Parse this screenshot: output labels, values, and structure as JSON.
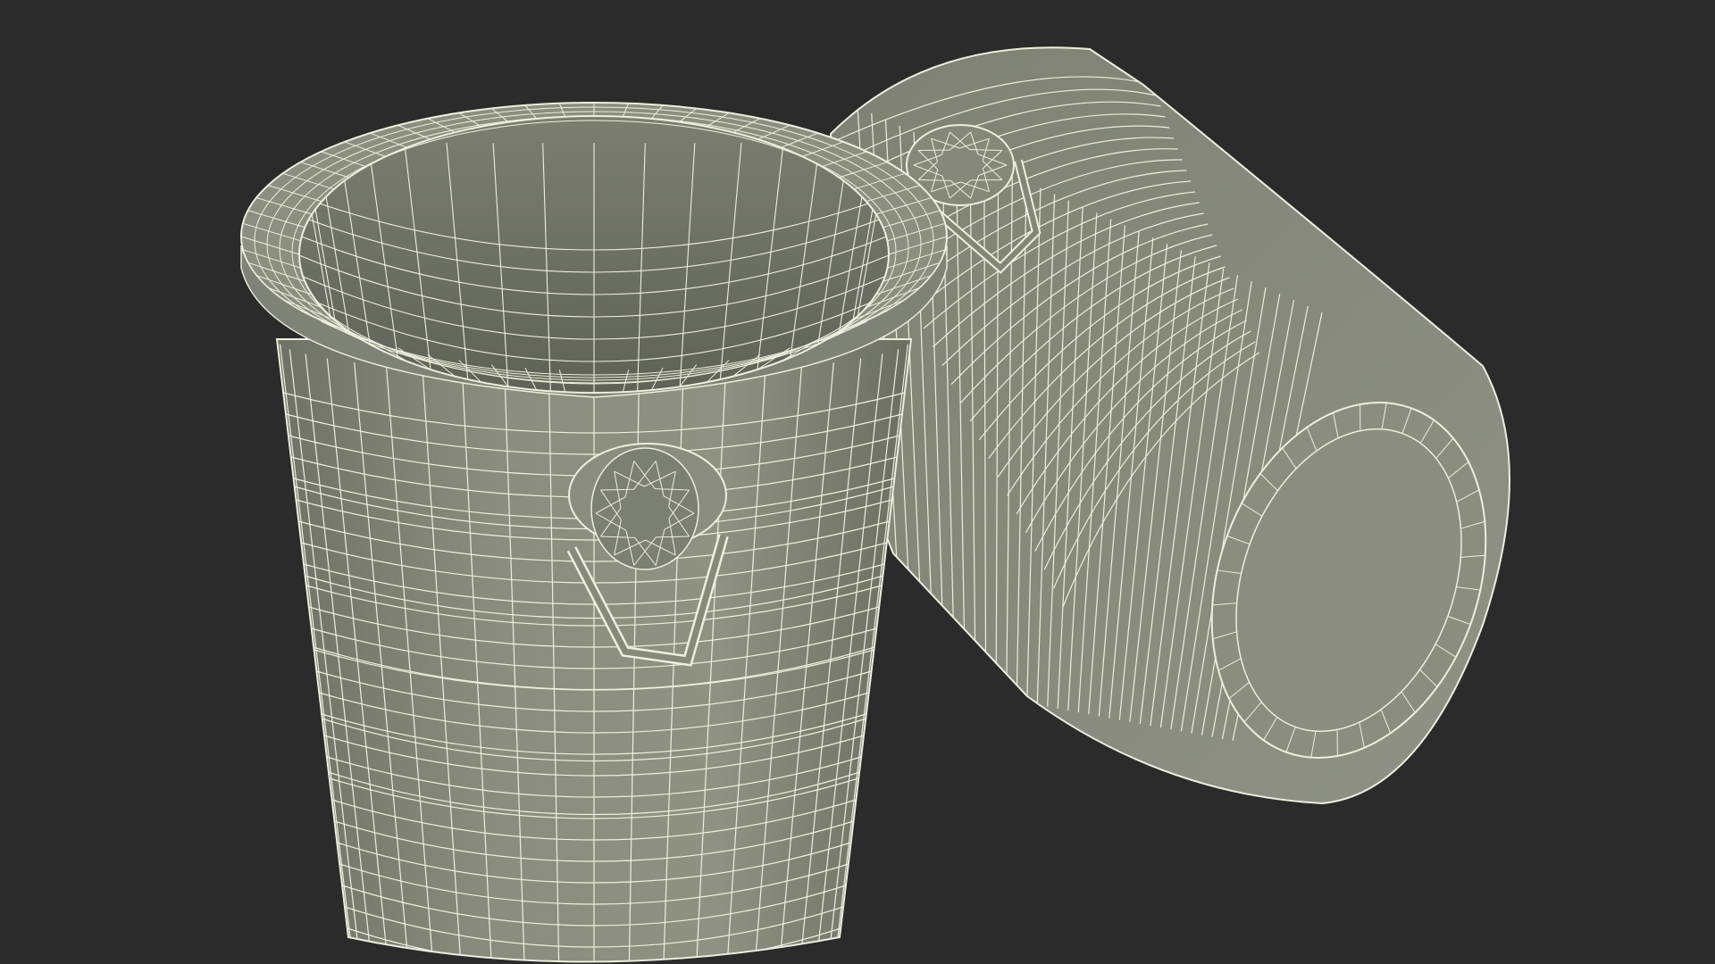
{
  "viewport": {
    "background": "#2b2b2b"
  },
  "render": {
    "style": "wireframe-on-shaded",
    "surface_color": "#85887a",
    "wire_color": "#eeeedd"
  },
  "objects": [
    {
      "name": "upright-bucket",
      "state": "standing"
    },
    {
      "name": "tipped-bucket",
      "state": "lying on side"
    }
  ]
}
